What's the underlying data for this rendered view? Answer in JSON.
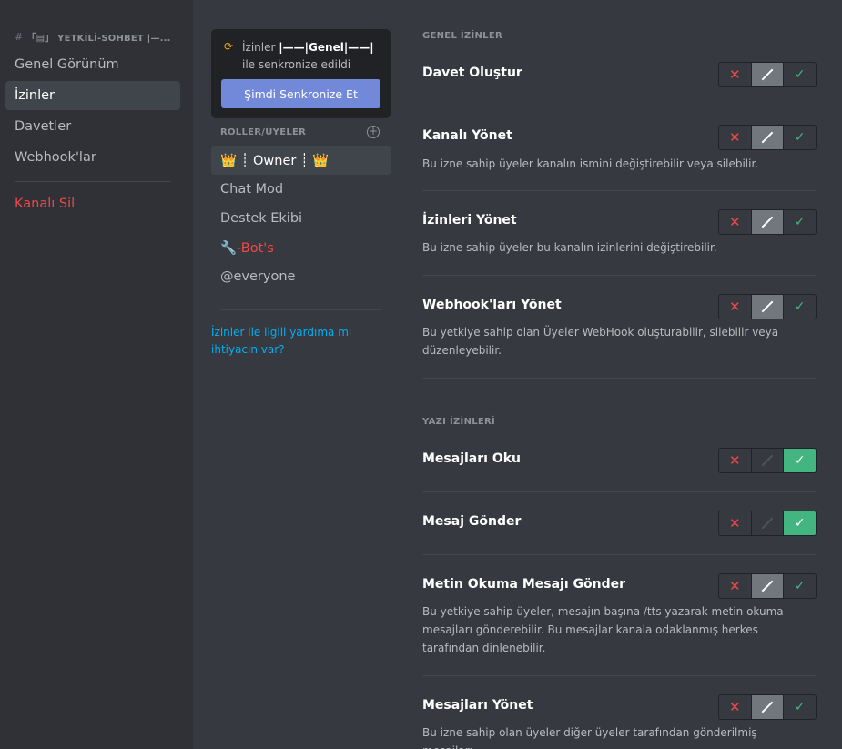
{
  "sidebar": {
    "channel_header": "「▤」 YETKİLİ-SOHBET |—...",
    "items": [
      {
        "label": "Genel Görünüm"
      },
      {
        "label": "İzinler"
      },
      {
        "label": "Davetler"
      },
      {
        "label": "Webhook'lar"
      }
    ],
    "delete_label": "Kanalı Sil"
  },
  "sync": {
    "text_prefix": "İzinler",
    "category": "|——|Genel|——|",
    "text_suffix": "ile senkronize edildi",
    "button_label": "Şimdi Senkronize Et"
  },
  "roles": {
    "header": "ROLLER/ÜYELER",
    "items": [
      {
        "label": "👑 ┊ Owner ┊ 👑"
      },
      {
        "label": "Chat Mod"
      },
      {
        "label": "Destek Ekibi"
      },
      {
        "label": "🔧-Bot's"
      },
      {
        "label": "@everyone"
      }
    ]
  },
  "help_link": "İzinler ile ilgili yardıma mı ihtiyacın var?",
  "sections": [
    {
      "header": "GENEL İZİNLER"
    },
    {
      "header": "YAZI İZİNLERİ"
    }
  ],
  "permissions": [
    {
      "title": "Davet Oluştur",
      "desc": "",
      "state": "pass"
    },
    {
      "title": "Kanalı Yönet",
      "desc": "Bu izne sahip üyeler kanalın ismini değiştirebilir veya silebilir.",
      "state": "pass"
    },
    {
      "title": "İzinleri Yönet",
      "desc": "Bu izne sahip üyeler bu kanalın izinlerini değiştirebilir.",
      "state": "pass"
    },
    {
      "title": "Webhook'ları Yönet",
      "desc": "Bu yetkiye sahip olan Üyeler WebHook oluşturabilir, silebilir veya düzenleyebilir.",
      "state": "pass"
    },
    {
      "title": "Mesajları Oku",
      "desc": "",
      "state": "allow"
    },
    {
      "title": "Mesaj Gönder",
      "desc": "",
      "state": "allow"
    },
    {
      "title": "Metin Okuma Mesajı Gönder",
      "desc": "Bu yetkiye sahip üyeler, mesajın başına /tts yazarak metin okuma mesajları gönderebilir. Bu mesajlar kanala odaklanmış herkes tarafından dinlenebilir.",
      "state": "pass"
    },
    {
      "title": "Mesajları Yönet",
      "desc": "Bu izne sahip olan üyeler diğer üyeler tarafından gönderilmiş mesajları",
      "state": "pass"
    }
  ],
  "toggle_icons": {
    "deny": "✕",
    "allow": "✓"
  },
  "colors": {
    "accent": "#7289da",
    "danger": "#f04747",
    "success": "#43b581",
    "link": "#00b0f4"
  }
}
